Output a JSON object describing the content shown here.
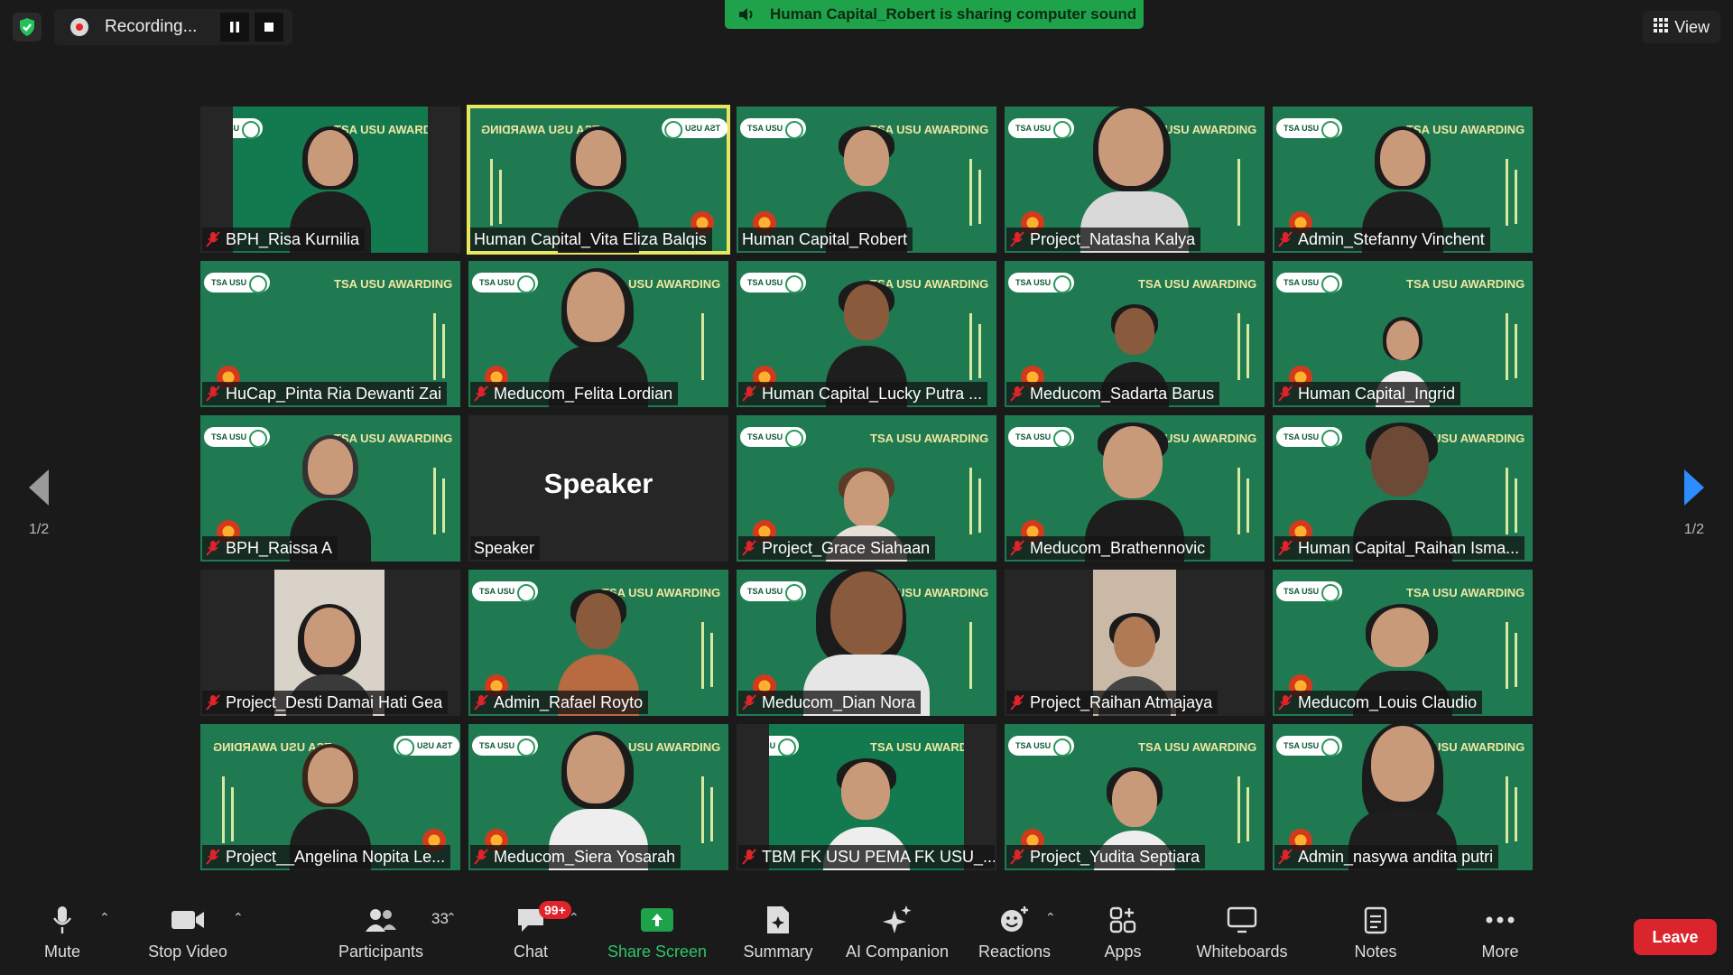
{
  "recording": {
    "label": "Recording..."
  },
  "share_banner": {
    "text": "Human Capital_Robert is sharing computer sound"
  },
  "view": {
    "label": "View"
  },
  "pagination": {
    "left": "1/2",
    "right": "1/2"
  },
  "brand": {
    "pill": "TSA USU",
    "award": "TSA USU AWARDING"
  },
  "speaker_tile": {
    "big": "Speaker",
    "name": "Speaker"
  },
  "participants": [
    "BPH_Risa Kurnilia",
    "Human Capital_Vita Eliza Balqis",
    "Human Capital_Robert",
    "Project_Natasha Kalya",
    "Admin_Stefanny Vinchent",
    "HuCap_Pinta Ria Dewanti Zai",
    "Meducom_Felita Lordian",
    "Human Capital_Lucky Putra ...",
    "Meducom_Sadarta Barus",
    "Human Capital_Ingrid",
    "BPH_Raissa A",
    "Speaker",
    "Project_Grace Siahaan",
    "Meducom_Brathennovic",
    "Human Capital_Raihan Isma...",
    "Project_Desti Damai Hati Gea",
    "Admin_Rafael Royto",
    "Meducom_Dian Nora",
    "Project_Raihan Atmajaya",
    "Meducom_Louis Claudio",
    "Project__Angelina Nopita Le...",
    "Meducom_Siera Yosarah",
    "TBM FK USU PEMA FK USU_...",
    "Project_Yudita Septiara",
    "Admin_nasywa andita putri"
  ],
  "toolbar": {
    "mute": "Mute",
    "stop_video": "Stop Video",
    "participants": "Participants",
    "participants_count": "33",
    "chat": "Chat",
    "chat_badge": "99+",
    "share_screen": "Share Screen",
    "summary": "Summary",
    "ai_companion": "AI Companion",
    "reactions": "Reactions",
    "apps": "Apps",
    "whiteboards": "Whiteboards",
    "notes": "Notes",
    "more": "More",
    "leave": "Leave"
  },
  "colors": {
    "background": "#1a1a1a",
    "brand_green": "#137a50",
    "share_green": "#1fa34a",
    "active_border": "#e9e660",
    "leave_red": "#d9252b",
    "muted_red": "#e0232b"
  }
}
